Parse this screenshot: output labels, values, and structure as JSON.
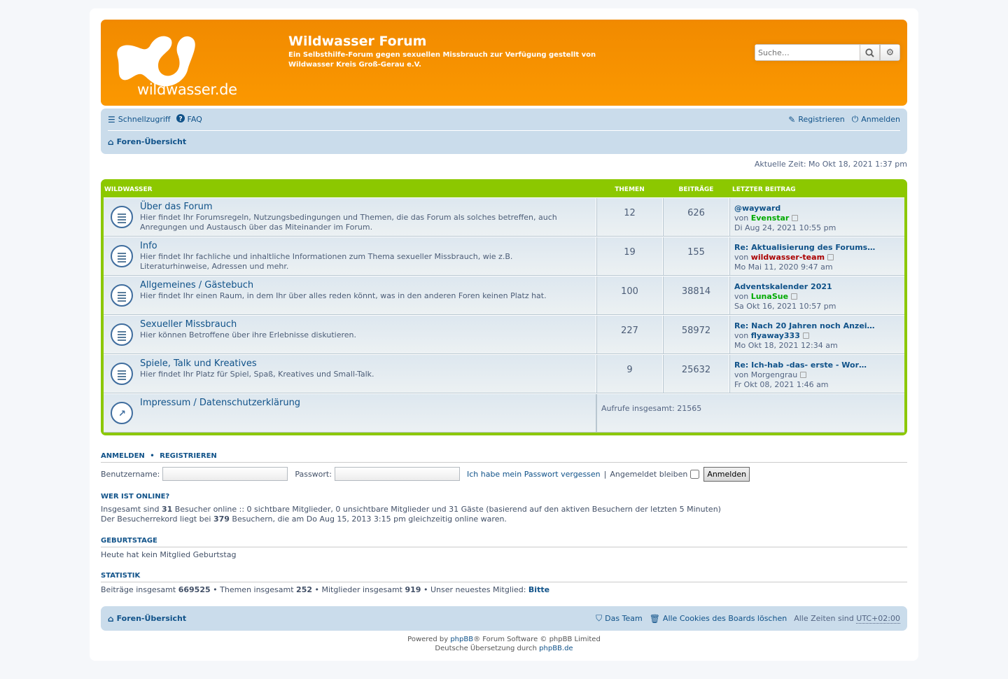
{
  "header": {
    "site_title": "Wildwasser Forum",
    "site_desc": "Ein Selbsthilfe-Forum gegen sexuellen Missbrauch zur Verfügung gestellt von Wildwasser Kreis Groß-Gerau e.V.",
    "logo_text": "wildwasser.de",
    "search_placeholder": "Suche…",
    "colors": {
      "header": "#fb9800",
      "navbar": "#cadceb",
      "forum_bar": "#8cc800"
    }
  },
  "navbar": {
    "quicklinks": "Schnellzugriff",
    "faq": "FAQ",
    "register": "Registrieren",
    "login": "Anmelden",
    "breadcrumb": "Foren-Übersicht"
  },
  "current_time": "Aktuelle Zeit: Mo Okt 18, 2021 1:37 pm",
  "forum_table": {
    "headers": {
      "category": "WILDWASSER",
      "topics": "THEMEN",
      "posts": "BEITRÄGE",
      "last_post": "LETZTER BEITRAG"
    },
    "forums": [
      {
        "title": "Über das Forum",
        "desc": "Hier findet Ihr Forumsregeln, Nutzungsbedingungen und Themen, die das Forum als solches betreffen, auch Anregungen und Austausch über das Miteinander im Forum.",
        "topics": "12",
        "posts": "626",
        "lp_title": "@wayward",
        "lp_by": "von ",
        "lp_user": "Evenstar",
        "lp_date": "Di Aug 24, 2021 10:55 pm"
      },
      {
        "title": "Info",
        "desc": "Hier findet Ihr fachliche und inhaltliche Informationen zum Thema sexueller Missbrauch, wie z.B. Literaturhinweise, Adressen und mehr.",
        "topics": "19",
        "posts": "155",
        "lp_title": "Re: Aktualisierung des Forums…",
        "lp_by": "von ",
        "lp_user": "wildwasser-team",
        "lp_date": "Mo Mai 11, 2020 9:47 am"
      },
      {
        "title": "Allgemeines / Gästebuch",
        "desc": "Hier findet Ihr einen Raum, in dem Ihr über alles reden könnt, was in den anderen Foren keinen Platz hat.",
        "topics": "100",
        "posts": "38814",
        "lp_title": "Adventskalender 2021",
        "lp_by": "von ",
        "lp_user": "LunaSue",
        "lp_date": "Sa Okt 16, 2021 10:57 pm"
      },
      {
        "title": "Sexueller Missbrauch",
        "desc": "Hier können Betroffene über ihre Erlebnisse diskutieren.",
        "topics": "227",
        "posts": "58972",
        "lp_title": "Re: Nach 20 Jahren noch Anzei…",
        "lp_by": "von ",
        "lp_user": "flyaway333",
        "lp_date": "Mo Okt 18, 2021 12:34 am"
      },
      {
        "title": "Spiele, Talk und Kreatives",
        "desc": "Hier findet Ihr Platz für Spiel, Spaß, Kreatives und Small-Talk.",
        "topics": "9",
        "posts": "25632",
        "lp_title": "Re: Ich-hab -das- erste - Wor…",
        "lp_by": "von Morgengrau",
        "lp_user": "",
        "lp_date": "Fr Okt 08, 2021 1:46 am"
      }
    ],
    "link_forum": {
      "title": "Impressum / Datenschutzerklärung",
      "views": "Aufrufe insgesamt: 21565"
    }
  },
  "login": {
    "title": "ANMELDEN",
    "sep": "•",
    "title2": "REGISTRIEREN",
    "username_label": "Benutzername:",
    "password_label": "Passwort:",
    "forgot": "Ich habe mein Passwort vergessen",
    "pipe": "|",
    "remember": "Angemeldet bleiben",
    "button": "Anmelden"
  },
  "online": {
    "title": "WER IST ONLINE?",
    "line1_a": "Insgesamt sind ",
    "line1_b": "31",
    "line1_c": " Besucher online :: 0 sichtbare Mitglieder, 0 unsichtbare Mitglieder und 31 Gäste (basierend auf den aktiven Besuchern der letzten 5 Minuten)",
    "line2_a": "Der Besucherrekord liegt bei ",
    "line2_b": "379",
    "line2_c": " Besuchern, die am Do Aug 15, 2013 3:15 pm gleichzeitig online waren."
  },
  "birthdays": {
    "title": "GEBURTSTAGE",
    "text": "Heute hat kein Mitglied Geburtstag"
  },
  "stats": {
    "title": "STATISTIK",
    "posts_label": "Beiträge insgesamt ",
    "posts": "669525",
    "topics_label": " • Themen insgesamt ",
    "topics": "252",
    "members_label": " • Mitglieder insgesamt ",
    "members": "919",
    "newest_label": " • Unser neuestes Mitglied: ",
    "newest": "Bitte"
  },
  "footer": {
    "breadcrumb": "Foren-Übersicht",
    "team": "Das Team",
    "cookies": "Alle Cookies des Boards löschen",
    "tz_label": "Alle Zeiten sind ",
    "tz": "UTC+02:00",
    "powered_a": "Powered by ",
    "powered_link": "phpBB",
    "powered_b": "® Forum Software © phpBB Limited",
    "translation_a": "Deutsche Übersetzung durch ",
    "translation_link": "phpBB.de"
  }
}
